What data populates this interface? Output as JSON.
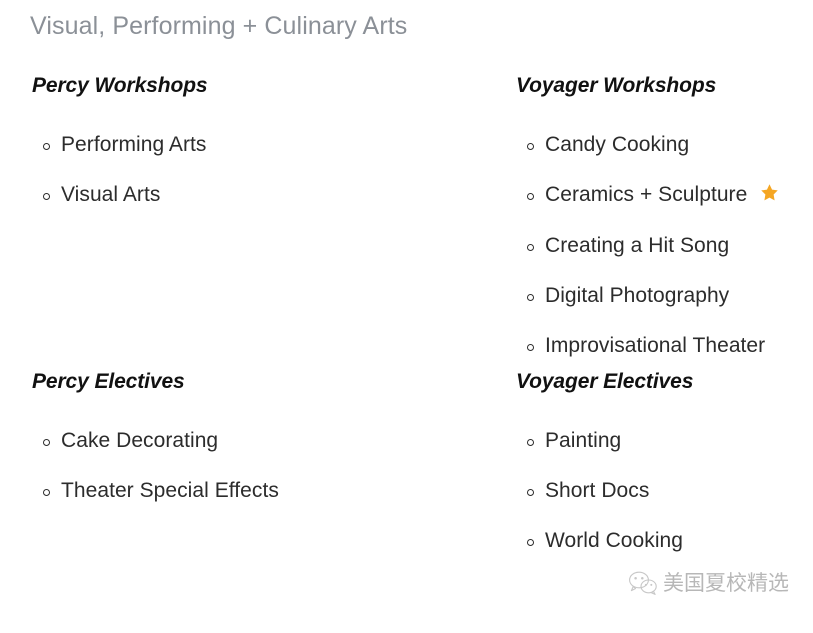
{
  "page": {
    "title": "Visual, Performing + Culinary Arts"
  },
  "colors": {
    "title": "#8b9097",
    "heading": "#111111",
    "body_text": "#2c2c2c",
    "star_accent": "#f5a623",
    "background": "#ffffff",
    "watermark": "#7d7d7d"
  },
  "sections": {
    "percy_workshops": {
      "heading": "Percy Workshops",
      "items": [
        {
          "label": "Performing Arts",
          "starred": false
        },
        {
          "label": "Visual Arts",
          "starred": false
        }
      ]
    },
    "voyager_workshops": {
      "heading": "Voyager Workshops",
      "items": [
        {
          "label": "Candy Cooking",
          "starred": false
        },
        {
          "label": "Ceramics + Sculpture",
          "starred": true
        },
        {
          "label": "Creating a Hit Song",
          "starred": false
        },
        {
          "label": "Digital Photography",
          "starred": false
        },
        {
          "label": "Improvisational Theater",
          "starred": false
        }
      ]
    },
    "percy_electives": {
      "heading": "Percy Electives",
      "items": [
        {
          "label": "Cake Decorating",
          "starred": false
        },
        {
          "label": "Theater Special Effects",
          "starred": false
        }
      ]
    },
    "voyager_electives": {
      "heading": "Voyager Electives",
      "items": [
        {
          "label": "Painting",
          "starred": false
        },
        {
          "label": "Short Docs",
          "starred": false
        },
        {
          "label": "World Cooking",
          "starred": false
        }
      ]
    }
  },
  "watermark": {
    "text": "美国夏校精选",
    "logo": "wechat-logo-icon"
  }
}
